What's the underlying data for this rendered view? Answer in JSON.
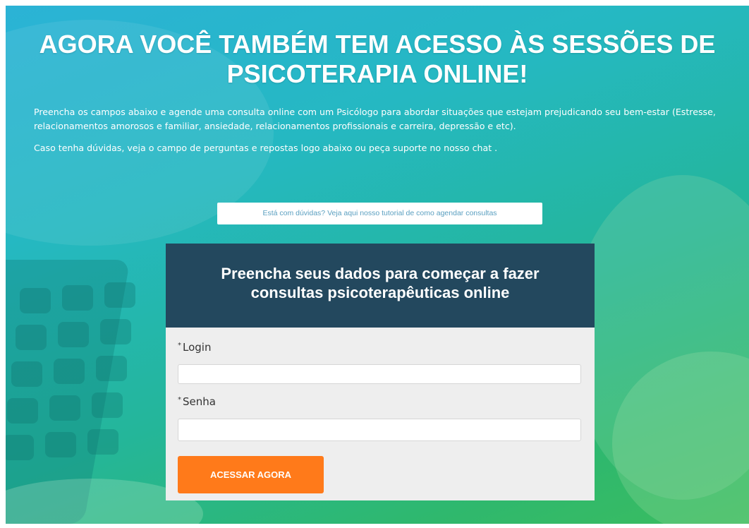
{
  "hero": {
    "headline_line1": "AGORA VOCÊ TAMBÉM TEM ACESSO ÀS SESSÕES DE",
    "headline_line2": "PSICOTERAPIA ONLINE!",
    "intro_paragraph1": "Preencha os campos abaixo e agende uma consulta online com um Psicólogo para abordar situações que estejam prejudicando seu bem-estar (Estresse, relacionamentos amorosos e familiar, ansiedade, relacionamentos profissionais e carreira, depressão e etc).",
    "intro_paragraph2": "Caso tenha dúvidas, veja o campo de perguntas e repostas logo abaixo ou peça suporte no nosso chat .",
    "tutorial_button": "Está com dúvidas? Veja aqui nosso tutorial de como agendar consultas"
  },
  "form": {
    "header_line1": "Preencha seus dados para começar a fazer",
    "header_line2": "consultas psicoterapêuticas online",
    "login_label": "Login",
    "login_value": "",
    "password_label": "Senha",
    "password_value": "",
    "required_marker": "*",
    "submit_label": "ACESSAR AGORA"
  },
  "colors": {
    "form_header_bg": "#23485e",
    "form_body_bg": "#eeeeee",
    "submit_bg": "#ff7a1a",
    "tutorial_text": "#5a9fc0",
    "hero_gradient_top": "#2bb3d6",
    "hero_gradient_bottom": "#3bbd5f"
  }
}
